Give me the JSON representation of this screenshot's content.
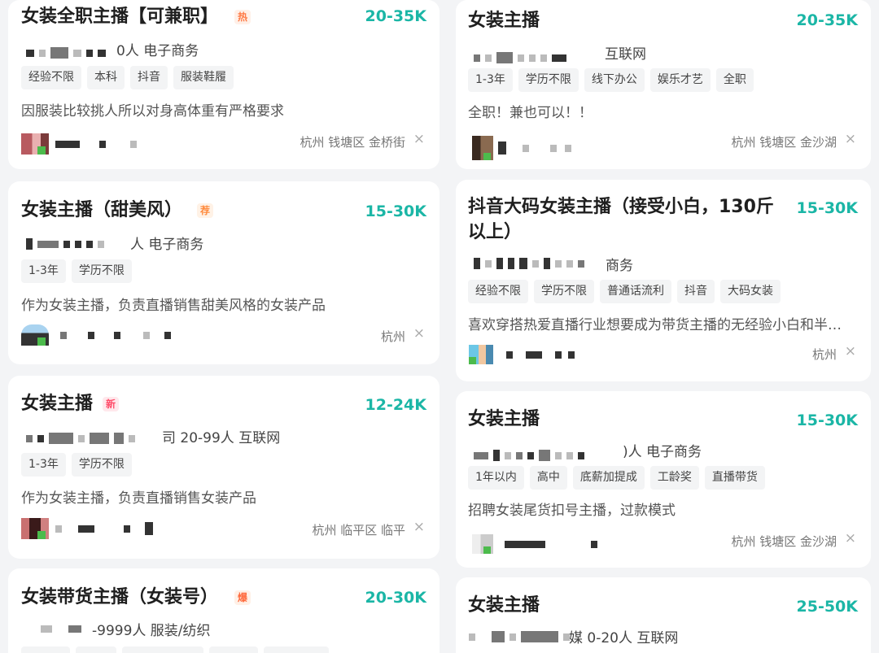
{
  "jobs": [
    {
      "title": "女装全职主播【可兼职】",
      "badge": "热",
      "salary": "20-35K",
      "company": "0人 电子商务",
      "tags": [
        "经验不限",
        "本科",
        "抖音",
        "服装鞋履"
      ],
      "desc": "因服装比较挑人所以对身高体重有严格要求",
      "location": "杭州 钱塘区 金桥街"
    },
    {
      "title": "女装主播（甜美风）",
      "badge": "荐",
      "salary": "15-30K",
      "company": "人 电子商务",
      "tags": [
        "1-3年",
        "学历不限"
      ],
      "desc": "作为女装主播，负责直播销售甜美风格的女装产品",
      "location": "杭州"
    },
    {
      "title": "女装主播",
      "badge": "新",
      "salary": "12-24K",
      "company": "司 20-99人 互联网",
      "tags": [
        "1-3年",
        "学历不限"
      ],
      "desc": "作为女装主播，负责直播销售女装产品",
      "location": "杭州 临平区 临平"
    },
    {
      "title": "女装带货主播（女装号）",
      "badge": "爆",
      "salary": "20-30K",
      "company": "-9999人 服装/纺织",
      "tags": [],
      "desc": "",
      "location": ""
    },
    {
      "title": "女装主播",
      "badge": "",
      "salary": "20-35K",
      "company": "互联网",
      "tags": [
        "1-3年",
        "学历不限",
        "线下办公",
        "娱乐才艺",
        "全职"
      ],
      "desc": "全职！兼也可以！！",
      "location": "杭州 钱塘区 金沙湖"
    },
    {
      "title": "抖音大码女装主播（接受小白，130斤以上）",
      "badge": "",
      "salary": "15-30K",
      "company": "商务",
      "tags": [
        "经验不限",
        "学历不限",
        "普通话流利",
        "抖音",
        "大码女装"
      ],
      "desc": "喜欢穿搭热爱直播行业想要成为带货主播的无经验小白和半…",
      "location": "杭州"
    },
    {
      "title": "女装主播",
      "badge": "",
      "salary": "15-30K",
      "company": ")人 电子商务",
      "tags": [
        "1年以内",
        "高中",
        "底薪加提成",
        "工龄奖",
        "直播带货"
      ],
      "desc": "招聘女装尾货扣号主播，过款模式",
      "location": "杭州 钱塘区 金沙湖"
    },
    {
      "title": "女装主播",
      "badge": "",
      "salary": "25-50K",
      "company": "媒 0-20人 互联网",
      "tags": [],
      "desc": "",
      "location": ""
    }
  ],
  "close_glyph": "×",
  "badge_colors": {
    "热": "#ff7a45",
    "荐": "#ff8a3d",
    "新": "#ff4d6a",
    "爆": "#ff6a3d"
  },
  "accent": "#1bb6a6"
}
